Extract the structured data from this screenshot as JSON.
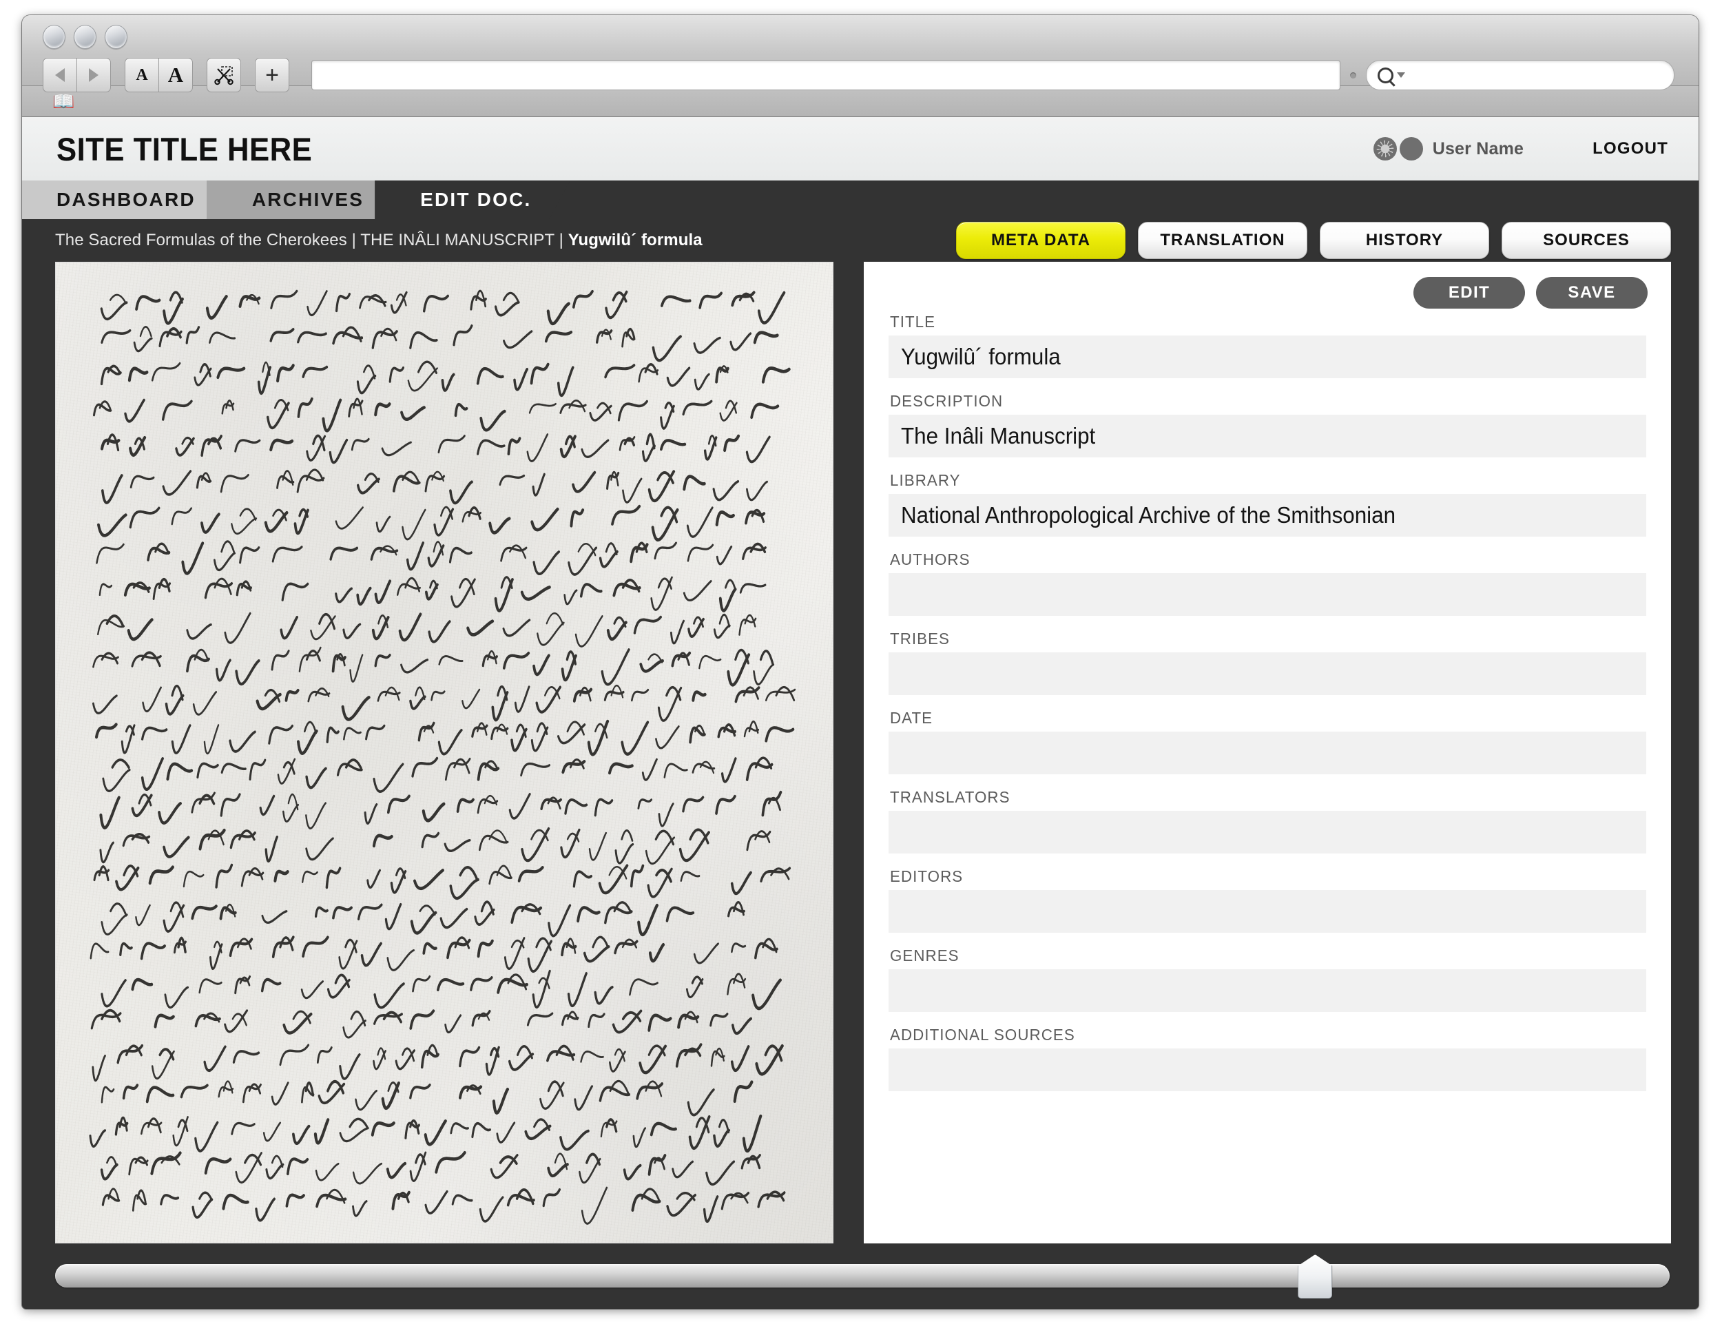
{
  "browser": {
    "toolbar": {
      "back_icon": "triangle-left-icon",
      "forward_icon": "triangle-right-icon",
      "text_smaller_label": "A",
      "text_larger_label": "A",
      "clip_icon": "scissors-icon",
      "add_label": "+",
      "address_value": "",
      "address_placeholder": "",
      "search_value": "",
      "search_placeholder": "",
      "search_icon": "search-icon",
      "search_dropdown_icon": "chevron-down-icon"
    },
    "bookmarks_icon": "open-book-icon"
  },
  "header": {
    "site_title": "SITE TITLE HERE",
    "gear_icon": "gear-icon",
    "avatar_icon": "avatar-icon",
    "user_name": "User Name",
    "logout_label": "LOGOUT"
  },
  "nav": {
    "tabs": [
      {
        "label": "DASHBOARD",
        "active": false
      },
      {
        "label": "ARCHIVES",
        "active": false
      },
      {
        "label": "EDIT DOC.",
        "active": true
      }
    ]
  },
  "breadcrumb": {
    "collection": "The Sacred Formulas of the Cherokees",
    "sep1": " | ",
    "manuscript": "THE INÂLI MANUSCRIPT",
    "sep2": " | ",
    "document": "Yugwilû´ formula"
  },
  "doc_tabs": [
    {
      "label": "META DATA",
      "active": true
    },
    {
      "label": "TRANSLATION",
      "active": false
    },
    {
      "label": "HISTORY",
      "active": false
    },
    {
      "label": "SOURCES",
      "active": false
    }
  ],
  "actions": {
    "edit_label": "EDIT",
    "save_label": "SAVE"
  },
  "image_panel": {
    "alt": "Handwritten Cherokee syllabary manuscript page scan"
  },
  "metadata_fields": [
    {
      "label": "TITLE",
      "value": "Yugwilû´ formula"
    },
    {
      "label": "DESCRIPTION",
      "value": "The Inâli Manuscript"
    },
    {
      "label": "LIBRARY",
      "value": "National Anthropological Archive of the Smithsonian"
    },
    {
      "label": "AUTHORS",
      "value": ""
    },
    {
      "label": "TRIBES",
      "value": ""
    },
    {
      "label": "DATE",
      "value": ""
    },
    {
      "label": "TRANSLATORS",
      "value": ""
    },
    {
      "label": "EDITORS",
      "value": ""
    },
    {
      "label": "GENRES",
      "value": ""
    },
    {
      "label": "ADDITIONAL SOURCES",
      "value": ""
    }
  ],
  "slider": {
    "position_percent": 78
  },
  "colors": {
    "accent_yellow": "#ecec08",
    "work_dark": "#333333",
    "tab_active": "#333333",
    "tab_1": "#c9c9c9",
    "tab_2": "#a6a6a6",
    "field_bg": "#f1f1f1",
    "button_gray": "#5e5e5e"
  }
}
